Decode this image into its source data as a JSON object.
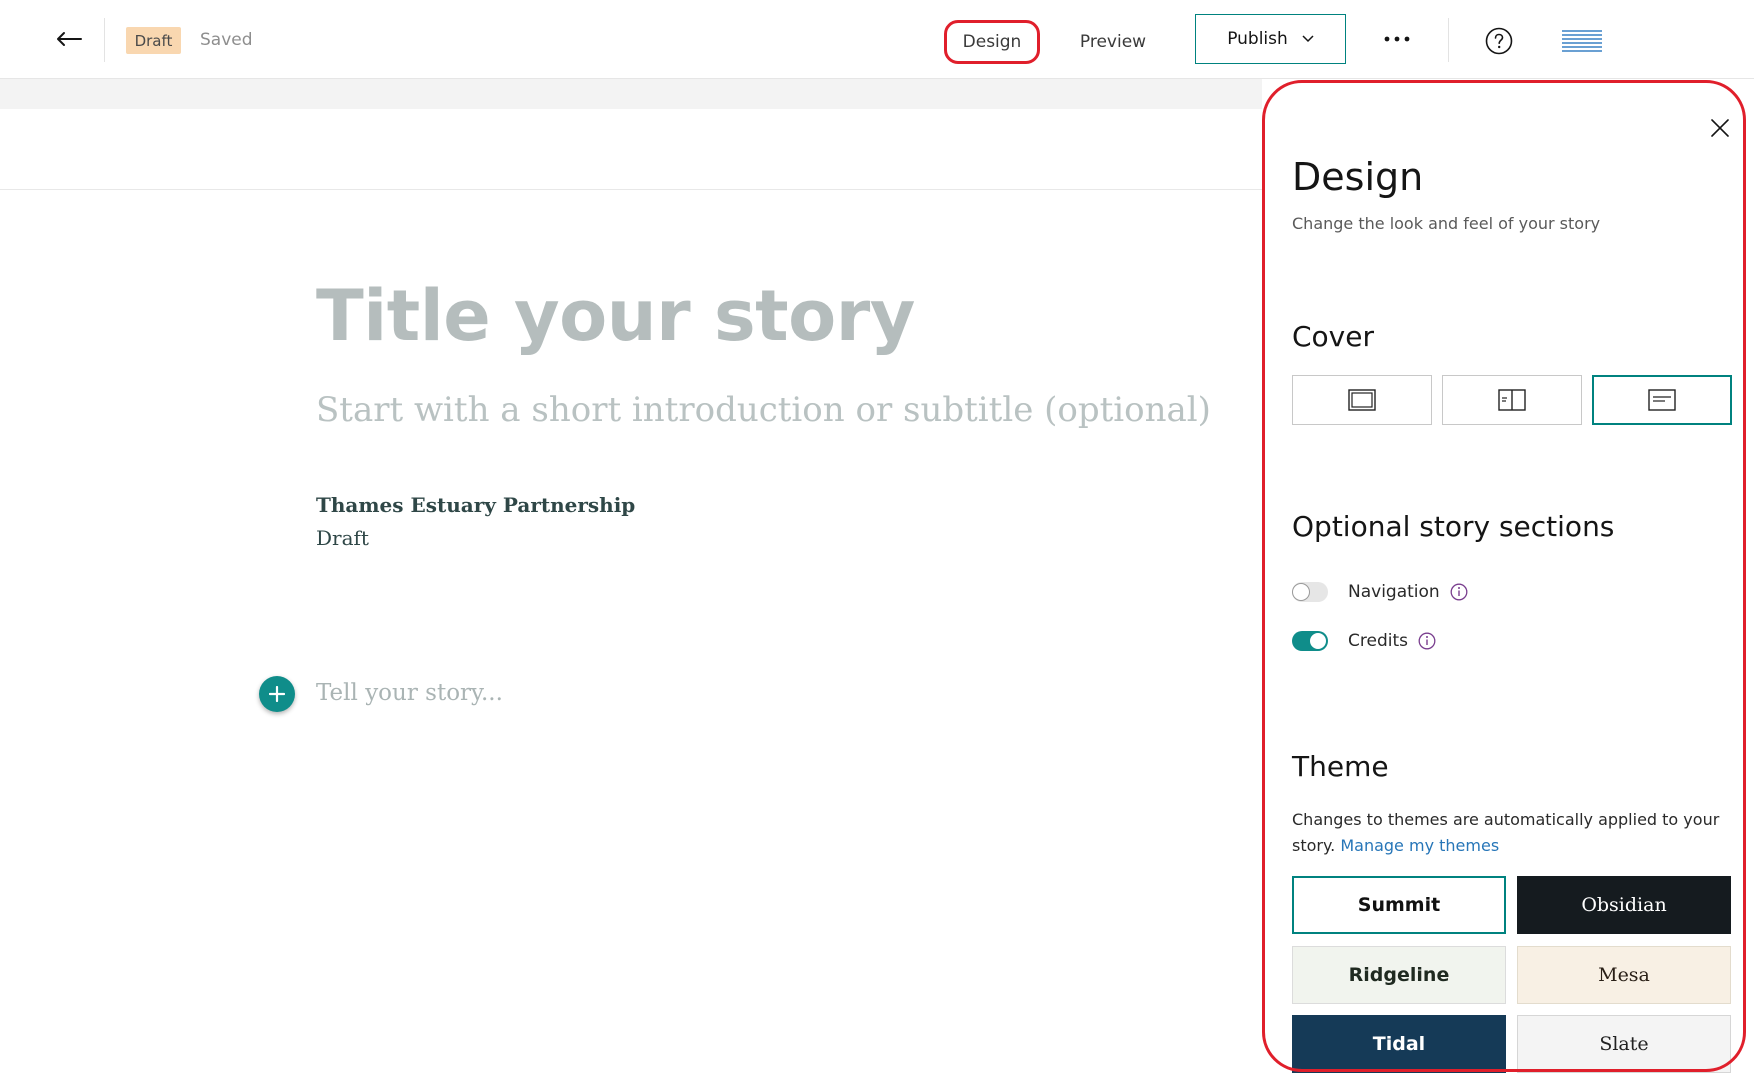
{
  "header": {
    "draft_badge": "Draft",
    "saved_status": "Saved",
    "design_label": "Design",
    "preview_label": "Preview",
    "publish_label": "Publish",
    "icons": {
      "back": "arrow-left-icon",
      "publish_dropdown": "chevron-down-icon",
      "more": "more-horizontal-icon",
      "help": "question-circle-icon"
    }
  },
  "story": {
    "title_placeholder": "Title your story",
    "subtitle_placeholder": "Start with a short introduction or subtitle (optional)",
    "author": "Thames Estuary Partnership",
    "status": "Draft",
    "body_placeholder": "Tell your story..."
  },
  "design_panel": {
    "title": "Design",
    "description": "Change the look and feel of your story",
    "cover": {
      "heading": "Cover",
      "options": [
        {
          "icon": "cover-full-icon",
          "selected": false
        },
        {
          "icon": "cover-split-icon",
          "selected": false
        },
        {
          "icon": "cover-minimal-icon",
          "selected": true
        }
      ]
    },
    "optional_sections": {
      "heading": "Optional story sections",
      "items": [
        {
          "label": "Navigation",
          "enabled": false
        },
        {
          "label": "Credits",
          "enabled": true
        }
      ]
    },
    "theme": {
      "heading": "Theme",
      "description": "Changes to themes are automatically applied to your story.",
      "manage_link": "Manage my themes",
      "options": [
        "Summit",
        "Obsidian",
        "Ridgeline",
        "Mesa",
        "Tidal",
        "Slate"
      ],
      "selected": "Summit"
    }
  },
  "colors": {
    "accent": "#00827f",
    "toggle_on": "#0f8d8a",
    "highlight_outline": "#e01f2b",
    "draft_badge": "#f9d7b0",
    "link": "#2776b8"
  }
}
